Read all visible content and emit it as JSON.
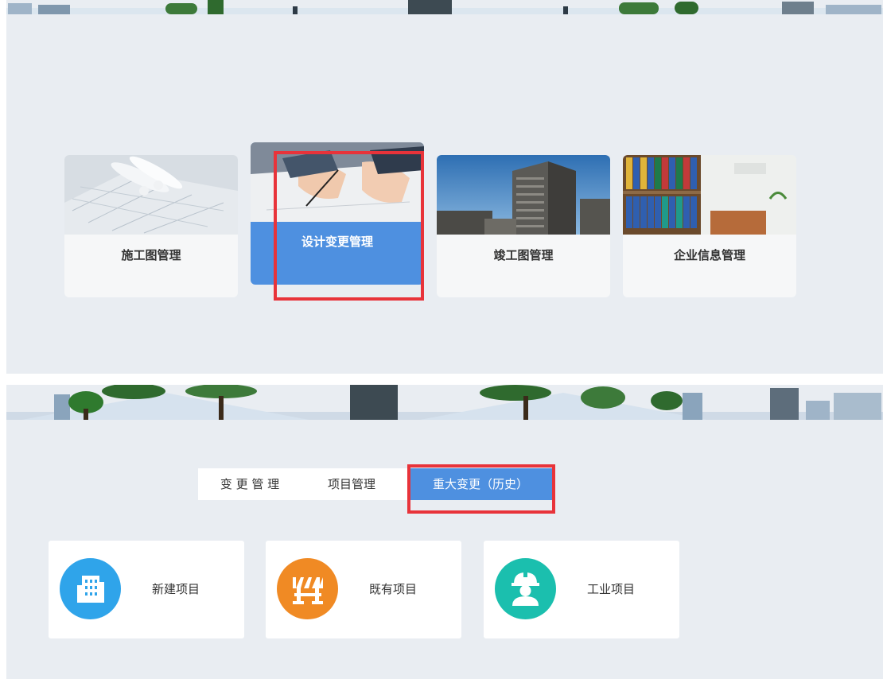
{
  "colors": {
    "panel_bg": "#e9edf2",
    "accent_blue": "#4e90e0",
    "highlight_red": "#e8333a",
    "icon_blue": "#2fa4ea",
    "icon_orange": "#f08a24",
    "icon_teal": "#1bbfae"
  },
  "modules": [
    {
      "label": "施工图管理",
      "icon": "blueprint-photo",
      "active": false
    },
    {
      "label": "设计变更管理",
      "icon": "signing-contract-photo",
      "active": true
    },
    {
      "label": "竣工图管理",
      "icon": "building-photo",
      "active": false
    },
    {
      "label": "企业信息管理",
      "icon": "binders-shelf-photo",
      "active": false
    }
  ],
  "tabs": [
    {
      "label": "变 更 管 理",
      "active": false
    },
    {
      "label": "项目管理",
      "active": false
    },
    {
      "label": "重大变更（历史）",
      "active": true
    }
  ],
  "projects": [
    {
      "label": "新建项目",
      "icon": "building-icon"
    },
    {
      "label": "既有项目",
      "icon": "roadblock-icon"
    },
    {
      "label": "工业项目",
      "icon": "worker-helmet-icon"
    }
  ]
}
